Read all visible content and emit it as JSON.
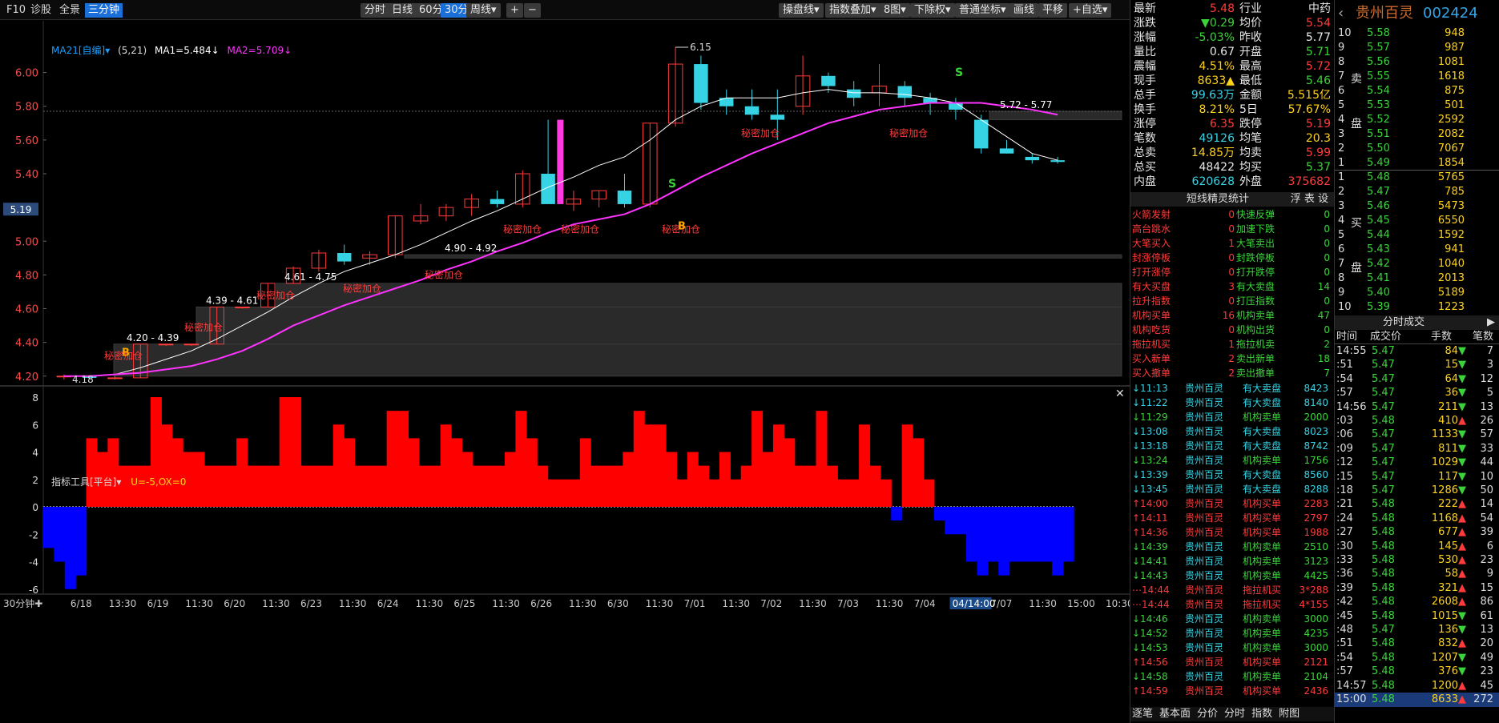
{
  "toolbar": {
    "left": [
      "F10",
      "诊股",
      "全景",
      "三分钟"
    ],
    "periods": [
      "分时",
      "日线",
      "60分",
      "30分",
      "周线▾"
    ],
    "zoom": [
      "+",
      "−"
    ],
    "right": [
      "操盘线▾",
      "指数叠加▾",
      "8图▾",
      "下除权▾",
      "普通坐标▾",
      "画线",
      "平移",
      "+自选▾"
    ]
  },
  "ma": {
    "selector": "MA21[自编]▾",
    "params": "(5,21)",
    "ma1": "MA1=5.484↓",
    "ma2": "MA2=5.709↓"
  },
  "indicator": {
    "tool": "指标工具[平台]▾",
    "params": "U=-5,OX=0"
  },
  "price_axis": [
    "6.00",
    "5.80",
    "5.60",
    "5.40",
    "5.19",
    "5.00",
    "4.80",
    "4.60",
    "4.40",
    "4.20"
  ],
  "osc_axis": [
    "8",
    "6",
    "4",
    "2",
    "0",
    "-2",
    "-4",
    "-6"
  ],
  "time_axis": [
    "30分钟✚",
    "6/18",
    "13:30",
    "6/19",
    "11:30",
    "6/20",
    "11:30",
    "6/23",
    "11:30",
    "6/24",
    "11:30",
    "6/25",
    "11:30",
    "6/26",
    "11:30",
    "6/30",
    "11:30",
    "7/01",
    "11:30",
    "7/02",
    "11:30",
    "7/03",
    "11:30",
    "7/04",
    "04/14:00",
    "7/07",
    "11:30",
    "15:00",
    "10:30"
  ],
  "annotations": {
    "high": "6.15",
    "low": "4.18",
    "ranges": [
      "4.20 - 4.39",
      "4.39 - 4.61",
      "4.61 - 4.75",
      "4.90 - 4.92",
      "5.72 - 5.77"
    ],
    "secret": "秘密加仓",
    "buy": "B",
    "sell": "S"
  },
  "chart_data": {
    "type": "candlestick",
    "symbol": "贵州百灵",
    "code": "002424",
    "interval": "30分钟",
    "ylim": [
      4.18,
      6.15
    ],
    "candles": [
      [
        4.2,
        4.21,
        4.18,
        4.2
      ],
      [
        4.2,
        4.2,
        4.18,
        4.19
      ],
      [
        4.19,
        4.2,
        4.18,
        4.19
      ],
      [
        4.19,
        4.39,
        4.19,
        4.39
      ],
      [
        4.39,
        4.39,
        4.38,
        4.39
      ],
      [
        4.39,
        4.39,
        4.38,
        4.39
      ],
      [
        4.39,
        4.61,
        4.39,
        4.61
      ],
      [
        4.61,
        4.61,
        4.6,
        4.61
      ],
      [
        4.61,
        4.75,
        4.61,
        4.75
      ],
      [
        4.75,
        4.85,
        4.75,
        4.84
      ],
      [
        4.84,
        4.95,
        4.82,
        4.93
      ],
      [
        4.93,
        4.98,
        4.86,
        4.88
      ],
      [
        4.9,
        4.94,
        4.86,
        4.92
      ],
      [
        4.92,
        5.15,
        4.9,
        5.15
      ],
      [
        5.12,
        5.22,
        5.1,
        5.15
      ],
      [
        5.15,
        5.22,
        5.12,
        5.2
      ],
      [
        5.2,
        5.28,
        5.15,
        5.25
      ],
      [
        5.25,
        5.3,
        5.2,
        5.22
      ],
      [
        5.22,
        5.42,
        5.2,
        5.4
      ],
      [
        5.4,
        5.72,
        5.25,
        5.22
      ],
      [
        5.22,
        5.3,
        5.18,
        5.25
      ],
      [
        5.25,
        5.3,
        5.2,
        5.3
      ],
      [
        5.3,
        5.4,
        5.2,
        5.22
      ],
      [
        5.22,
        5.7,
        5.2,
        5.7
      ],
      [
        5.7,
        6.15,
        5.68,
        6.05
      ],
      [
        6.05,
        6.1,
        5.78,
        5.82
      ],
      [
        5.85,
        5.9,
        5.75,
        5.8
      ],
      [
        5.8,
        5.9,
        5.72,
        5.75
      ],
      [
        5.75,
        5.9,
        5.6,
        5.72
      ],
      [
        5.8,
        6.1,
        5.75,
        5.98
      ],
      [
        5.98,
        6.0,
        5.88,
        5.92
      ],
      [
        5.9,
        5.95,
        5.8,
        5.85
      ],
      [
        5.88,
        6.05,
        5.8,
        5.92
      ],
      [
        5.92,
        5.95,
        5.8,
        5.85
      ],
      [
        5.85,
        5.88,
        5.75,
        5.82
      ],
      [
        5.82,
        5.85,
        5.72,
        5.78
      ],
      [
        5.72,
        5.75,
        5.52,
        5.55
      ],
      [
        5.55,
        5.6,
        5.52,
        5.52
      ],
      [
        5.5,
        5.52,
        5.46,
        5.48
      ],
      [
        5.48,
        5.5,
        5.46,
        5.47
      ]
    ],
    "ma1": [
      4.2,
      4.2,
      4.21,
      4.25,
      4.3,
      4.35,
      4.42,
      4.5,
      4.58,
      4.67,
      4.75,
      4.82,
      4.87,
      4.92,
      4.98,
      5.05,
      5.12,
      5.18,
      5.25,
      5.32,
      5.38,
      5.45,
      5.5,
      5.6,
      5.72,
      5.8,
      5.85,
      5.85,
      5.85,
      5.88,
      5.9,
      5.88,
      5.88,
      5.87,
      5.85,
      5.82,
      5.72,
      5.62,
      5.52,
      5.48
    ],
    "ma2": [
      4.2,
      4.2,
      4.21,
      4.22,
      4.24,
      4.26,
      4.3,
      4.35,
      4.42,
      4.5,
      4.56,
      4.62,
      4.67,
      4.72,
      4.77,
      4.83,
      4.88,
      4.94,
      4.99,
      5.05,
      5.1,
      5.13,
      5.16,
      5.22,
      5.3,
      5.38,
      5.45,
      5.52,
      5.58,
      5.64,
      5.7,
      5.74,
      5.78,
      5.8,
      5.82,
      5.82,
      5.82,
      5.8,
      5.78,
      5.75
    ],
    "osc": [
      -3,
      -4,
      -6,
      -5,
      5,
      4,
      5,
      3,
      3,
      3,
      8,
      6,
      5,
      4,
      4,
      3,
      3,
      3,
      5,
      3,
      3,
      3,
      8,
      8,
      3,
      3,
      3,
      6,
      5,
      3,
      3,
      3,
      7,
      7,
      5,
      3,
      3,
      6,
      5,
      4,
      3,
      3,
      3,
      4,
      7,
      5,
      3,
      2,
      2,
      2,
      5,
      3,
      3,
      3,
      4,
      7,
      6,
      6,
      4,
      2,
      4,
      3,
      2,
      4,
      2,
      3,
      7,
      4,
      6,
      5,
      3,
      3,
      7,
      3,
      2,
      2,
      6,
      3,
      2,
      -1,
      6,
      5,
      2,
      -1,
      -2,
      -2,
      -4,
      -5,
      -4,
      -5,
      -4,
      -4,
      -4,
      -4,
      -5,
      -4
    ]
  },
  "quote": {
    "rows": [
      [
        "最新",
        "5.48",
        "行业",
        "中药"
      ],
      [
        "涨跌",
        "▼0.29",
        "均价",
        "5.54"
      ],
      [
        "涨幅",
        "-5.03%",
        "昨收",
        "5.77"
      ],
      [
        "量比",
        "0.67",
        "开盘",
        "5.71"
      ],
      [
        "震幅",
        "4.51%",
        "最高",
        "5.72"
      ],
      [
        "现手",
        "8633▲",
        "最低",
        "5.46"
      ],
      [
        "总手",
        "99.63万",
        "金额",
        "5.515亿"
      ],
      [
        "换手",
        "8.21%",
        "5日",
        "57.67%"
      ],
      [
        "涨停",
        "6.35",
        "跌停",
        "5.19"
      ],
      [
        "笔数",
        "49126",
        "均笔",
        "20.3"
      ],
      [
        "总卖",
        "14.85万",
        "均卖",
        "5.99"
      ],
      [
        "总买",
        "48422",
        "均买",
        "5.37"
      ],
      [
        "内盘",
        "620628",
        "外盘",
        "375682"
      ]
    ],
    "colors": [
      "#ff3b3b",
      "#3bd43b",
      "#3bd43b",
      "#e8e8e8",
      "#ffd21a",
      "#ffd21a",
      "#36d3e4",
      "#ffd21a",
      "#ff3b3b",
      "#36d3e4",
      "#ffd21a",
      "#e8e8e8",
      "#36d3e4"
    ],
    "colors_r": [
      "#e8e8e8",
      "#ff3b3b",
      "#e8e8e8",
      "#3bd43b",
      "#ff3b3b",
      "#3bd43b",
      "#ffd21a",
      "#ffd21a",
      "#ff3b3b",
      "#ffd21a",
      "#ff3b3b",
      "#3bd43b",
      "#ff3b3b"
    ]
  },
  "elf": {
    "title": "短线精灵统计",
    "tabs": "浮 表 设",
    "rows": [
      [
        "火箭发射",
        "0",
        "快速反弹",
        "0"
      ],
      [
        "高台跳水",
        "0",
        "加速下跌",
        "0"
      ],
      [
        "大笔买入",
        "1",
        "大笔卖出",
        "0"
      ],
      [
        "封涨停板",
        "0",
        "封跌停板",
        "0"
      ],
      [
        "打开涨停",
        "0",
        "打开跌停",
        "0"
      ],
      [
        "有大买盘",
        "3",
        "有大卖盘",
        "14"
      ],
      [
        "拉升指数",
        "0",
        "打压指数",
        "0"
      ],
      [
        "机构买单",
        "16",
        "机构卖单",
        "47"
      ],
      [
        "机构吃货",
        "0",
        "机构出货",
        "0"
      ],
      [
        "拖拉机买",
        "1",
        "拖拉机卖",
        "2"
      ],
      [
        "买入新单",
        "2",
        "卖出新单",
        "18"
      ],
      [
        "买入撤单",
        "2",
        "卖出撤单",
        "7"
      ]
    ],
    "events": [
      [
        "↓11:13",
        "贵州百灵",
        "有大卖盘",
        "8423",
        "c"
      ],
      [
        "↓11:22",
        "贵州百灵",
        "有大卖盘",
        "8140",
        "c"
      ],
      [
        "↓11:29",
        "贵州百灵",
        "机构卖单",
        "2000",
        "g"
      ],
      [
        "↓13:08",
        "贵州百灵",
        "有大卖盘",
        "8023",
        "c"
      ],
      [
        "↓13:18",
        "贵州百灵",
        "有大卖盘",
        "8742",
        "c"
      ],
      [
        "↓13:24",
        "贵州百灵",
        "机构卖单",
        "1756",
        "g"
      ],
      [
        "↓13:39",
        "贵州百灵",
        "有大卖盘",
        "8560",
        "c"
      ],
      [
        "↓13:45",
        "贵州百灵",
        "有大卖盘",
        "8288",
        "c"
      ],
      [
        "↑14:00",
        "贵州百灵",
        "机构买单",
        "2283",
        "r"
      ],
      [
        "↑14:11",
        "贵州百灵",
        "机构买单",
        "2797",
        "r"
      ],
      [
        "↑14:36",
        "贵州百灵",
        "机构买单",
        "1988",
        "r"
      ],
      [
        "↓14:39",
        "贵州百灵",
        "机构卖单",
        "2510",
        "g"
      ],
      [
        "↓14:41",
        "贵州百灵",
        "机构卖单",
        "3123",
        "g"
      ],
      [
        "↓14:43",
        "贵州百灵",
        "机构卖单",
        "4425",
        "g"
      ],
      [
        "⋯14:44",
        "贵州百灵",
        "拖拉机买",
        "3*288",
        "r"
      ],
      [
        "⋯14:44",
        "贵州百灵",
        "拖拉机买",
        "4*155",
        "r"
      ],
      [
        "↓14:46",
        "贵州百灵",
        "机构卖单",
        "3000",
        "g"
      ],
      [
        "↓14:52",
        "贵州百灵",
        "机构卖单",
        "4235",
        "g"
      ],
      [
        "↓14:53",
        "贵州百灵",
        "机构卖单",
        "3000",
        "g"
      ],
      [
        "↑14:56",
        "贵州百灵",
        "机构买单",
        "2121",
        "r"
      ],
      [
        "↓14:58",
        "贵州百灵",
        "机构卖单",
        "2104",
        "g"
      ],
      [
        "↑14:59",
        "贵州百灵",
        "机构买单",
        "2436",
        "r"
      ]
    ],
    "footer": [
      "逐笔",
      "基本面",
      "分价",
      "分时",
      "指数",
      "附图"
    ]
  },
  "book": {
    "title": "贵州百灵",
    "code": "002424",
    "sell": [
      [
        "10",
        "5.58",
        "948"
      ],
      [
        "9",
        "5.57",
        "987"
      ],
      [
        "8",
        "5.56",
        "1081"
      ],
      [
        "7",
        "5.55",
        "1618"
      ],
      [
        "6",
        "5.54",
        "875"
      ],
      [
        "5",
        "5.53",
        "501"
      ],
      [
        "4",
        "5.52",
        "2592"
      ],
      [
        "3",
        "5.51",
        "2082"
      ],
      [
        "2",
        "5.50",
        "7067"
      ],
      [
        "1",
        "5.49",
        "1854"
      ]
    ],
    "buy": [
      [
        "1",
        "5.48",
        "5765"
      ],
      [
        "2",
        "5.47",
        "785"
      ],
      [
        "3",
        "5.46",
        "5473"
      ],
      [
        "4",
        "5.45",
        "6550"
      ],
      [
        "5",
        "5.44",
        "1592"
      ],
      [
        "6",
        "5.43",
        "941"
      ],
      [
        "7",
        "5.42",
        "1040"
      ],
      [
        "8",
        "5.41",
        "2013"
      ],
      [
        "9",
        "5.40",
        "5189"
      ],
      [
        "10",
        "5.39",
        "1223"
      ]
    ],
    "sell_label": [
      "卖",
      "盘"
    ],
    "buy_label": [
      "买",
      "盘"
    ],
    "trades_title": "分时成交",
    "trades_header": [
      "时间",
      "成交价",
      "手数",
      "笔数"
    ],
    "trades": [
      [
        "14:55",
        "5.47",
        "84▼",
        "7"
      ],
      [
        ":51",
        "5.47",
        "15▼",
        "3"
      ],
      [
        ":54",
        "5.47",
        "64▼",
        "12"
      ],
      [
        ":57",
        "5.47",
        "36▼",
        "5"
      ],
      [
        "14:56",
        "5.47",
        "211▼",
        "13"
      ],
      [
        ":03",
        "5.48",
        "410▲",
        "26"
      ],
      [
        ":06",
        "5.47",
        "1133▼",
        "57"
      ],
      [
        ":09",
        "5.47",
        "811▼",
        "33"
      ],
      [
        ":12",
        "5.47",
        "1029▼",
        "44"
      ],
      [
        ":15",
        "5.47",
        "117▼",
        "10"
      ],
      [
        ":18",
        "5.47",
        "1286▼",
        "50"
      ],
      [
        ":21",
        "5.48",
        "222▲",
        "14"
      ],
      [
        ":24",
        "5.48",
        "1168▲",
        "54"
      ],
      [
        ":27",
        "5.48",
        "677▲",
        "39"
      ],
      [
        ":30",
        "5.48",
        "145▲",
        "6"
      ],
      [
        ":33",
        "5.48",
        "530▲",
        "23"
      ],
      [
        ":36",
        "5.48",
        "58▲",
        "9"
      ],
      [
        ":39",
        "5.48",
        "321▲",
        "15"
      ],
      [
        ":42",
        "5.48",
        "2608▲",
        "86"
      ],
      [
        ":45",
        "5.48",
        "1015▼",
        "61"
      ],
      [
        ":48",
        "5.47",
        "136▼",
        "13"
      ],
      [
        ":51",
        "5.48",
        "832▲",
        "20"
      ],
      [
        ":54",
        "5.48",
        "1207▼",
        "49"
      ],
      [
        ":57",
        "5.48",
        "376▼",
        "23"
      ],
      [
        "14:57",
        "5.48",
        "1200▲",
        "45"
      ],
      [
        "15:00",
        "5.48",
        "8633▲",
        "272"
      ]
    ]
  }
}
